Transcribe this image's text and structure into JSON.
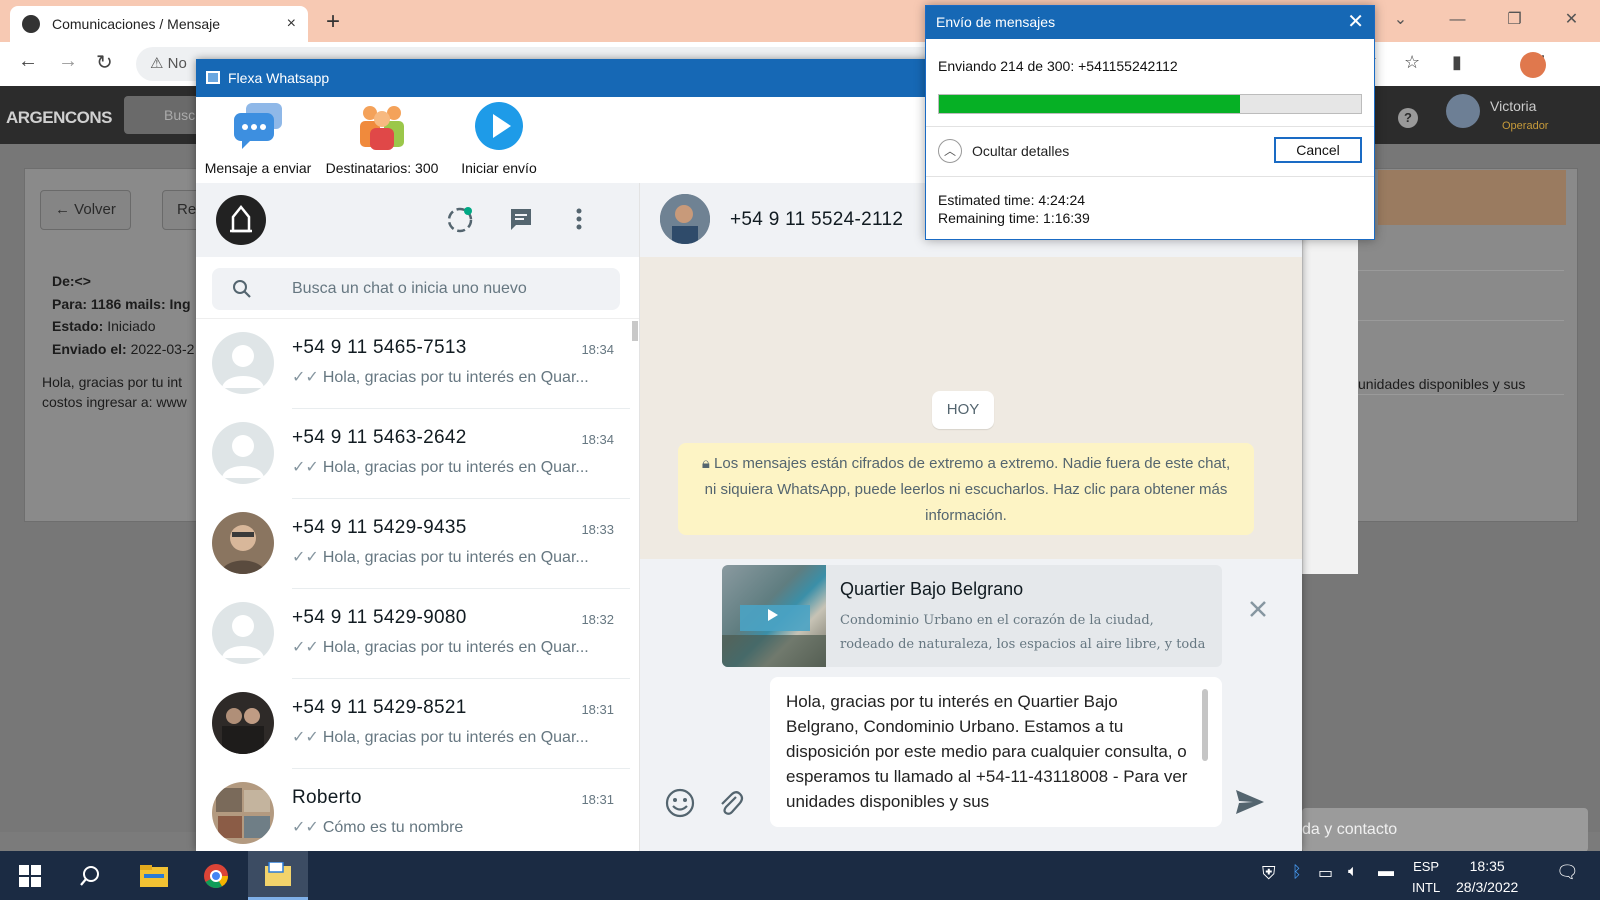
{
  "browser": {
    "tab_title": "Comunicaciones / Mensaje",
    "tab_close": "×",
    "new_tab": "+",
    "address_text": "No"
  },
  "webapp": {
    "brand": "ARGENCONS",
    "search_placeholder": "Busc",
    "user_name": "Victoria",
    "user_role": "Operador",
    "back_button": "Volver",
    "second_button": "Re",
    "from_label": "De:<>",
    "to_label": "Para: 1186 mails: Ing",
    "state_label": "Estado:",
    "state_value": "Iniciado",
    "sent_label": "Enviado el:",
    "sent_value": "2022-03-2",
    "body_text": "Hola, gracias por tu int costos ingresar a: www",
    "right_text": "unidades disponibles y sus",
    "bottom_input": "da y contacto"
  },
  "flexa": {
    "title": "Flexa Whatsapp",
    "toolbar": {
      "message_label": "Mensaje a enviar",
      "recipients_label": "Destinatarios: 300",
      "start_label": "Iniciar envío"
    }
  },
  "whatsapp": {
    "search_placeholder": "Busca un chat o inicia uno nuevo",
    "chats": [
      {
        "name": "+54 9 11 5465-7513",
        "time": "18:34",
        "preview": "Hola, gracias por tu interés en Quar..."
      },
      {
        "name": "+54 9 11 5463-2642",
        "time": "18:34",
        "preview": "Hola, gracias por tu interés en Quar..."
      },
      {
        "name": "+54 9 11 5429-9435",
        "time": "18:33",
        "preview": "Hola, gracias por tu interés en Quar..."
      },
      {
        "name": "+54 9 11 5429-9080",
        "time": "18:32",
        "preview": "Hola, gracias por tu interés en Quar..."
      },
      {
        "name": "+54 9 11 5429-8521",
        "time": "18:31",
        "preview": "Hola, gracias por tu interés en Quar..."
      },
      {
        "name": "Roberto",
        "time": "18:31",
        "preview": "Cómo es tu nombre"
      }
    ],
    "contact_name": "+54 9 11 5524-2112",
    "today_badge": "HOY",
    "encryption_notice": "Los mensajes están cifrados de extremo a extremo. Nadie fuera de este chat, ni siquiera WhatsApp, puede leerlos ni escucharlos. Haz clic para obtener más información.",
    "link_preview": {
      "title": "Quartier Bajo Belgrano",
      "description": "Condominio Urbano en el corazón de la ciudad, rodeado de naturaleza, los espacios al aire libre, y toda"
    },
    "message_text": "Hola, gracias por tu interés en Quartier Bajo Belgrano, Condominio Urbano. Estamos a tu disposición por este medio para cualquier consulta, o esperamos tu llamado al +54-11-43118008  - Para ver unidades disponibles y sus"
  },
  "dialog": {
    "title": "Envío de mensajes",
    "status": "Enviando 214 de 300: +541155242112",
    "progress": 0.713,
    "details_toggle": "Ocultar detalles",
    "cancel_label": "Cancel",
    "estimated_time": "Estimated time: 4:24:24",
    "remaining_time": "Remaining time: 1:16:39"
  },
  "taskbar": {
    "lang_top": "ESP",
    "lang_bottom": "INTL",
    "time": "18:35",
    "date": "28/3/2022"
  },
  "colors": {
    "accent_blue": "#1668b5",
    "progress_green": "#06b025",
    "encrypt_bg": "#fdf4c5",
    "taskbar": "#1b2b43"
  }
}
